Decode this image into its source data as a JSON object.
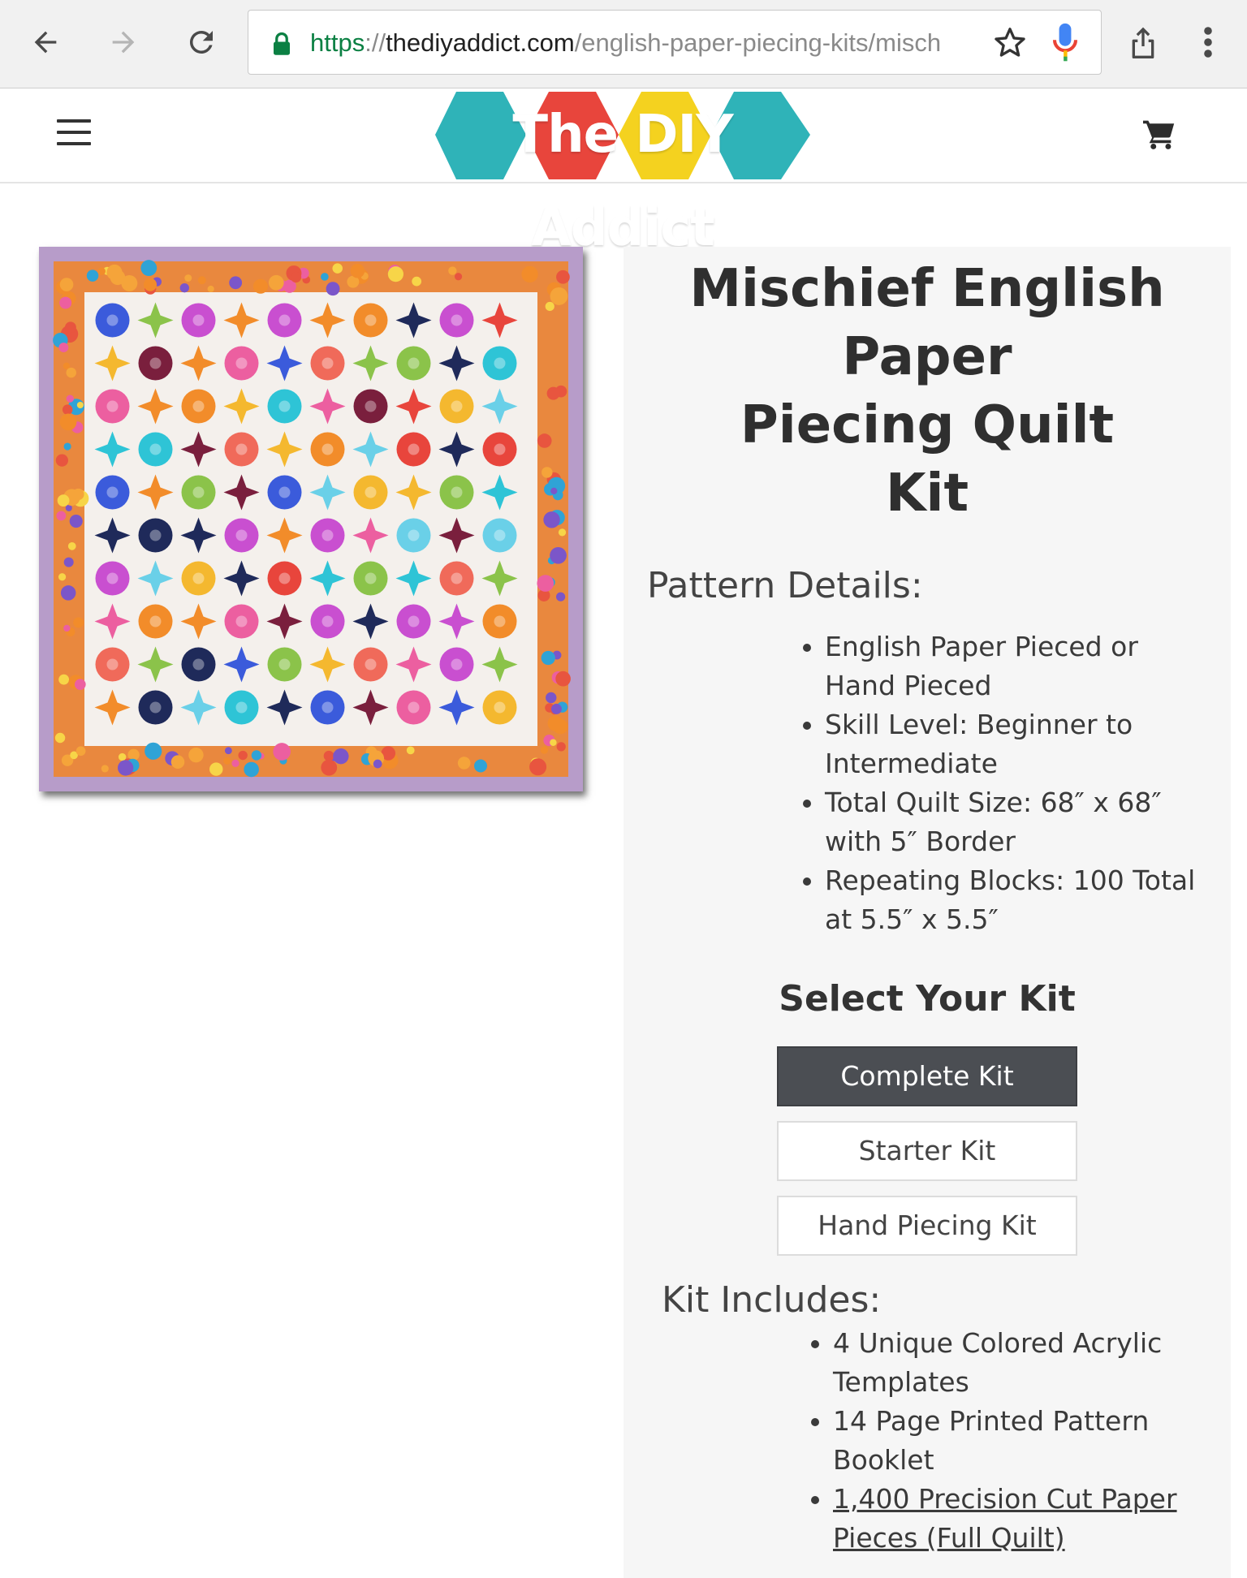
{
  "browser": {
    "url_scheme": "https",
    "url_separator": "://",
    "url_host": "thediyaddict.com",
    "url_path": "/english-paper-piecing-kits/misch",
    "icons": [
      "back-arrow-icon",
      "forward-arrow-icon",
      "reload-icon",
      "lock-icon",
      "star-icon",
      "mic-icon",
      "share-icon",
      "overflow-menu-icon"
    ]
  },
  "header": {
    "logo_text": "The DIY Addict",
    "logo_colors": [
      "#2fb3b8",
      "#e8453c",
      "#f4d21f",
      "#2fb3b8"
    ],
    "icons": [
      "hamburger-menu-icon",
      "shopping-cart-icon"
    ]
  },
  "product": {
    "image_alt": "Mischief English Paper Piecing Quilt",
    "title_lines": [
      "Mischief English",
      "Paper",
      "Piecing Quilt",
      "Kit"
    ],
    "pattern_heading": "Pattern Details:",
    "pattern_details": [
      [
        "English Paper Pieced or",
        "Hand Pieced"
      ],
      [
        "Skill Level: Beginner to",
        "Intermediate"
      ],
      [
        "Total Quilt Size: 68″ x 68″",
        "with 5″ Border"
      ],
      [
        "Repeating Blocks: 100 Total",
        "at 5.5″ x 5.5″"
      ]
    ],
    "select_heading": "Select Your Kit",
    "kits": [
      {
        "label": "Complete Kit",
        "selected": true
      },
      {
        "label": "Starter Kit",
        "selected": false
      },
      {
        "label": "Hand Piecing Kit",
        "selected": false
      }
    ],
    "includes_heading": "Kit Includes:",
    "includes": [
      [
        "4 Unique Colored Acrylic",
        "Templates"
      ],
      [
        "14 Page Printed Pattern",
        "Booklet"
      ],
      [
        "1,400 Precision Cut Paper",
        "Pieces (Full Quilt)"
      ]
    ]
  }
}
